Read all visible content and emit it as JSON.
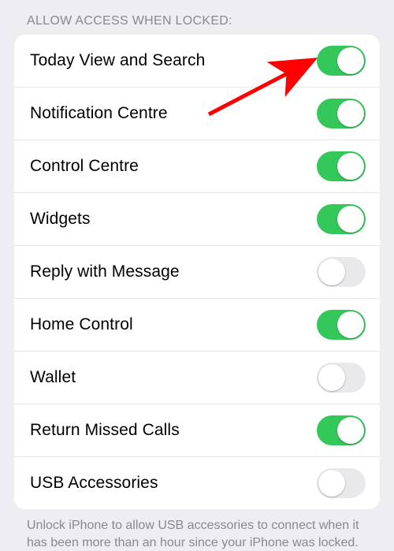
{
  "section_header": "ALLOW ACCESS WHEN LOCKED:",
  "rows": [
    {
      "label": "Today View and Search",
      "on": true
    },
    {
      "label": "Notification Centre",
      "on": true
    },
    {
      "label": "Control Centre",
      "on": true
    },
    {
      "label": "Widgets",
      "on": true
    },
    {
      "label": "Reply with Message",
      "on": false
    },
    {
      "label": "Home Control",
      "on": true
    },
    {
      "label": "Wallet",
      "on": false
    },
    {
      "label": "Return Missed Calls",
      "on": true
    },
    {
      "label": "USB Accessories",
      "on": false
    }
  ],
  "footer_note": "Unlock iPhone to allow USB accessories to connect when it has been more than an hour since your iPhone was locked.",
  "colors": {
    "toggle_on": "#34c85a",
    "toggle_off": "#e9e9eb",
    "arrow": "#ff0000"
  },
  "annotation": {
    "arrow_points_to_row_index": 0
  }
}
